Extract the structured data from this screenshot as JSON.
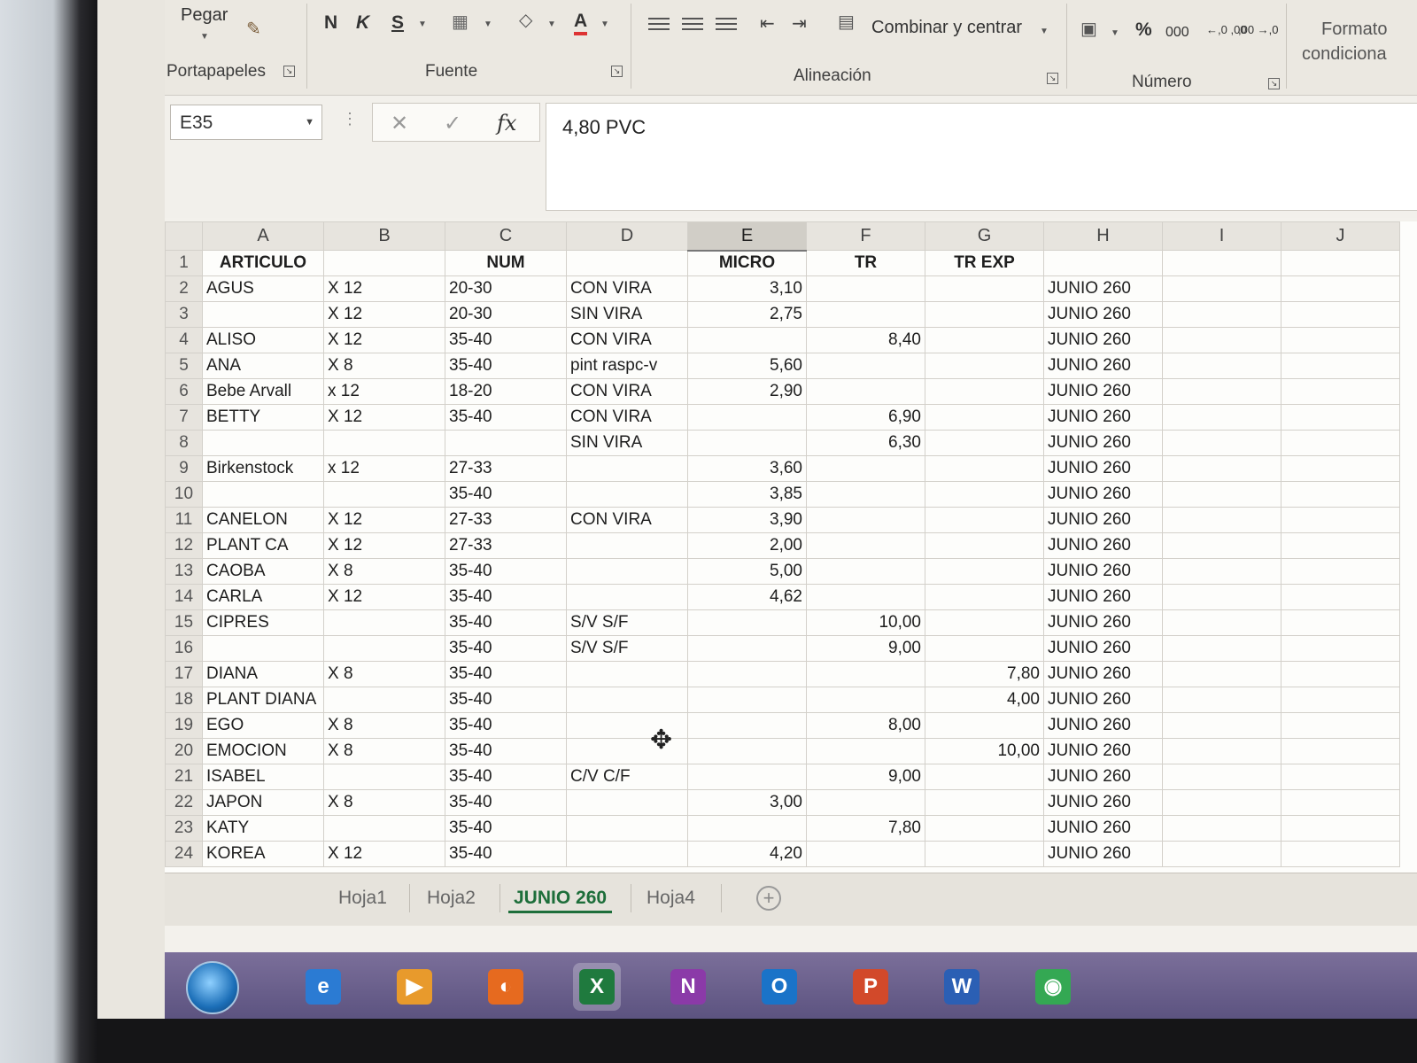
{
  "ribbon": {
    "clipboard": {
      "paste_label": "Pegar",
      "group_label": "Portapapeles"
    },
    "font": {
      "bold": "N",
      "italic": "K",
      "underline": "S",
      "font_color_glyph": "A",
      "group_label": "Fuente"
    },
    "alignment": {
      "merge_label": "Combinar y centrar",
      "group_label": "Alineación"
    },
    "number": {
      "percent": "%",
      "thousands": "000",
      "increase_decimals": "←,0 ,00",
      "decrease_decimals": ",00 →,0",
      "group_label": "Número"
    },
    "styles": {
      "conditional_format_line1": "Formato",
      "conditional_format_line2": "condiciona"
    }
  },
  "formula_bar": {
    "name_box": "E35",
    "cancel_glyph": "✕",
    "enter_glyph": "✓",
    "function_glyph": "fx",
    "content": "4,80 PVC"
  },
  "grid": {
    "columns": [
      "A",
      "B",
      "C",
      "D",
      "E",
      "F",
      "G",
      "H",
      "I",
      "J"
    ],
    "active_column": "E",
    "header_row": {
      "row": "1",
      "A": "ARTICULO",
      "B": "",
      "C": "NUM",
      "D": "",
      "E": "MICRO",
      "F": "TR",
      "G": "TR EXP",
      "H": ""
    },
    "rows": [
      {
        "row": "2",
        "A": "AGUS",
        "B": "X 12",
        "C": "20-30",
        "D": "CON VIRA",
        "E": "3,10",
        "F": "",
        "G": "",
        "H": "JUNIO 260"
      },
      {
        "row": "3",
        "A": "",
        "B": "X 12",
        "C": "20-30",
        "D": "SIN VIRA",
        "E": "2,75",
        "F": "",
        "G": "",
        "H": "JUNIO 260"
      },
      {
        "row": "4",
        "A": "ALISO",
        "B": "X 12",
        "C": "35-40",
        "D": "CON VIRA",
        "E": "",
        "F": "8,40",
        "G": "",
        "H": "JUNIO 260"
      },
      {
        "row": "5",
        "A": "ANA",
        "B": "X 8",
        "C": "35-40",
        "D": "pint raspc-v",
        "E": "5,60",
        "F": "",
        "G": "",
        "H": "JUNIO 260"
      },
      {
        "row": "6",
        "A": "Bebe Arvall",
        "B": "x 12",
        "C": "18-20",
        "D": "CON VIRA",
        "E": "2,90",
        "F": "",
        "G": "",
        "H": "JUNIO 260"
      },
      {
        "row": "7",
        "A": "BETTY",
        "B": "X 12",
        "C": "35-40",
        "D": "CON VIRA",
        "E": "",
        "F": "6,90",
        "G": "",
        "H": "JUNIO 260"
      },
      {
        "row": "8",
        "A": "",
        "B": "",
        "C": "",
        "D": "SIN VIRA",
        "E": "",
        "F": "6,30",
        "G": "",
        "H": "JUNIO 260"
      },
      {
        "row": "9",
        "A": "Birkenstock",
        "B": "x 12",
        "C": "27-33",
        "D": "",
        "E": "3,60",
        "F": "",
        "G": "",
        "H": "JUNIO 260"
      },
      {
        "row": "10",
        "A": "",
        "B": "",
        "C": "35-40",
        "D": "",
        "E": "3,85",
        "F": "",
        "G": "",
        "H": "JUNIO 260"
      },
      {
        "row": "11",
        "A": "CANELON",
        "B": "X 12",
        "C": "27-33",
        "D": "CON VIRA",
        "E": "3,90",
        "F": "",
        "G": "",
        "H": "JUNIO 260"
      },
      {
        "row": "12",
        "A": "PLANT CA",
        "B": "X 12",
        "C": "27-33",
        "D": "",
        "E": "2,00",
        "F": "",
        "G": "",
        "H": "JUNIO 260"
      },
      {
        "row": "13",
        "A": "CAOBA",
        "B": "X 8",
        "C": "35-40",
        "D": "",
        "E": "5,00",
        "F": "",
        "G": "",
        "H": "JUNIO 260"
      },
      {
        "row": "14",
        "A": "CARLA",
        "B": "X 12",
        "C": "35-40",
        "D": "",
        "E": "4,62",
        "F": "",
        "G": "",
        "H": "JUNIO 260"
      },
      {
        "row": "15",
        "A": "CIPRES",
        "B": "",
        "C": "35-40",
        "D": "S/V S/F",
        "E": "",
        "F": "10,00",
        "G": "",
        "H": "JUNIO 260"
      },
      {
        "row": "16",
        "A": "",
        "B": "",
        "C": "35-40",
        "D": "S/V S/F",
        "E": "",
        "F": "9,00",
        "G": "",
        "H": "JUNIO 260"
      },
      {
        "row": "17",
        "A": "DIANA",
        "B": "X 8",
        "C": "35-40",
        "D": "",
        "E": "",
        "F": "",
        "G": "7,80",
        "H": "JUNIO 260"
      },
      {
        "row": "18",
        "A": "PLANT DIANA",
        "B": "",
        "C": "35-40",
        "D": "",
        "E": "",
        "F": "",
        "G": "4,00",
        "H": "JUNIO 260"
      },
      {
        "row": "19",
        "A": "EGO",
        "B": "X 8",
        "C": "35-40",
        "D": "",
        "E": "",
        "F": "8,00",
        "G": "",
        "H": "JUNIO 260"
      },
      {
        "row": "20",
        "A": "EMOCION",
        "B": "X 8",
        "C": "35-40",
        "D": "",
        "E": "",
        "F": "",
        "G": "10,00",
        "H": "JUNIO 260"
      },
      {
        "row": "21",
        "A": "ISABEL",
        "B": "",
        "C": "35-40",
        "D": "C/V C/F",
        "E": "",
        "F": "9,00",
        "G": "",
        "H": "JUNIO 260"
      },
      {
        "row": "22",
        "A": "JAPON",
        "B": "X 8",
        "C": "35-40",
        "D": "",
        "E": "3,00",
        "F": "",
        "G": "",
        "H": "JUNIO 260"
      },
      {
        "row": "23",
        "A": "KATY",
        "B": "",
        "C": "35-40",
        "D": "",
        "E": "",
        "F": "7,80",
        "G": "",
        "H": "JUNIO 260"
      },
      {
        "row": "24",
        "A": "KOREA",
        "B": "X 12",
        "C": "35-40",
        "D": "",
        "E": "4,20",
        "F": "",
        "G": "",
        "H": "JUNIO 260"
      }
    ]
  },
  "sheet_tabs": [
    {
      "label": "Hoja1",
      "active": false
    },
    {
      "label": "Hoja2",
      "active": false
    },
    {
      "label": "JUNIO 260",
      "active": true
    },
    {
      "label": "Hoja4",
      "active": false
    }
  ],
  "add_sheet_glyph": "+",
  "taskbar": {
    "apps": [
      {
        "name": "internet-explorer",
        "glyph": "e",
        "color": "#2b7bd3"
      },
      {
        "name": "media-player",
        "glyph": "▶",
        "color": "#e89a2c"
      },
      {
        "name": "firefox",
        "glyph": "◐",
        "color": "#e66a1f"
      },
      {
        "name": "excel",
        "glyph": "X",
        "color": "#1f7a3e"
      },
      {
        "name": "onenote",
        "glyph": "N",
        "color": "#8b3aa8"
      },
      {
        "name": "outlook",
        "glyph": "O",
        "color": "#1a73c8"
      },
      {
        "name": "powerpoint",
        "glyph": "P",
        "color": "#d2492a"
      },
      {
        "name": "word",
        "glyph": "W",
        "color": "#2b5fb4"
      },
      {
        "name": "chrome",
        "glyph": "◉",
        "color": "#34a853"
      }
    ],
    "active_app": "excel"
  }
}
